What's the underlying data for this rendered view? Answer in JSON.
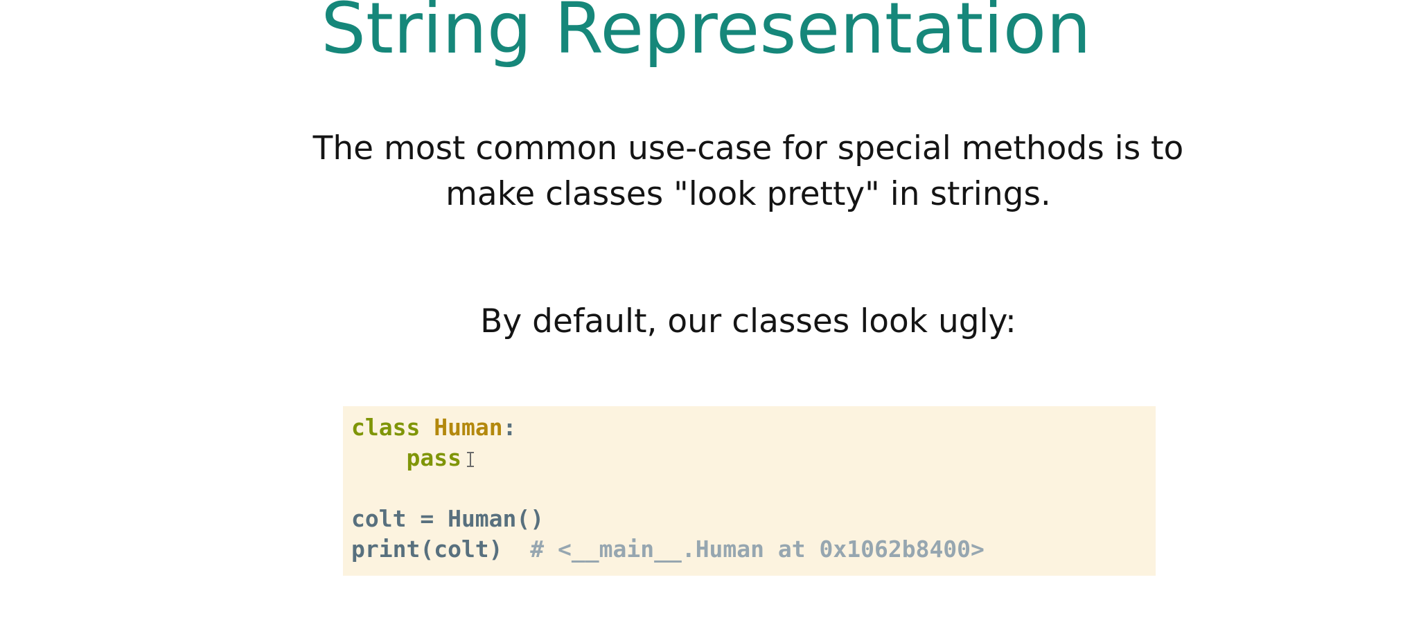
{
  "slide": {
    "title": "String Representation",
    "intro_line1": "The most common use-case for special methods is to",
    "intro_line2": "make classes \"look pretty\" in strings.",
    "subheading": "By default, our classes look ugly:"
  },
  "code": {
    "line1_keyword": "class",
    "line1_name": "Human",
    "line1_punct": ":",
    "line2_indent": "    ",
    "line2_keyword": "pass",
    "line4_text": "colt = Human()",
    "line5_code": "print(colt)  ",
    "line5_comment": "# <__main__.Human at 0x1062b8400>"
  },
  "colors": {
    "title": "#16877a",
    "code_background": "#fcf3df",
    "keyword": "#7f9508",
    "class_name": "#b3880d",
    "comment": "#96a6b0",
    "code_text": "#58707e"
  },
  "icons": {
    "text_cursor": "i-beam-cursor-icon"
  }
}
